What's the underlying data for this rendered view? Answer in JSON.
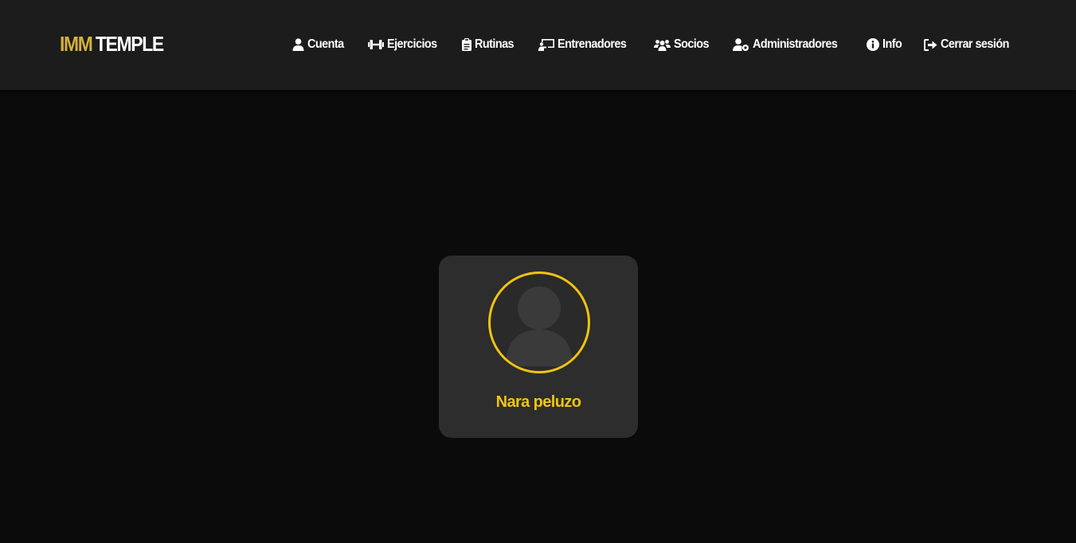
{
  "brand": {
    "accent": "IMM",
    "main": "TEMPLE"
  },
  "nav": {
    "items": [
      {
        "label": "Cuenta",
        "icon": "user-icon"
      },
      {
        "label": "Ejercicios",
        "icon": "dumbbell-icon"
      },
      {
        "label": "Rutinas",
        "icon": "clipboard-icon"
      },
      {
        "label": "Entrenadores",
        "icon": "chalkboard-teacher-icon"
      },
      {
        "label": "Socios",
        "icon": "users-icon"
      },
      {
        "label": "Administradores",
        "icon": "user-gear-icon"
      },
      {
        "label": "Info",
        "icon": "info-circle-icon"
      },
      {
        "label": "Cerrar sesión",
        "icon": "sign-out-icon"
      }
    ]
  },
  "profile": {
    "name": "Nara peluzo",
    "avatar_icon": "default-avatar-icon"
  },
  "colors": {
    "accent": "#f1c40f",
    "brand_accent": "#d4b23a",
    "navbar_bg": "#1c1c1c",
    "page_bg": "#0b0b0b",
    "card_bg": "#2d2d2d"
  }
}
